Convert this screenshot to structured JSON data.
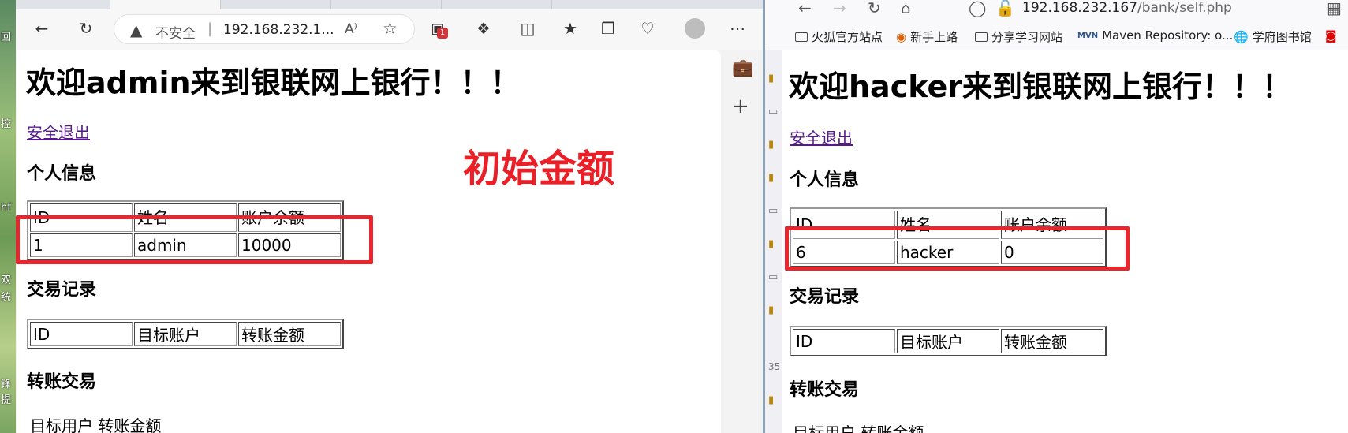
{
  "desktop": {
    "labels": [
      "回",
      "控",
      "hf",
      "双",
      "统",
      "锋",
      "提",
      "35"
    ]
  },
  "edge": {
    "address": {
      "insecure_label": "不安全",
      "separator": "|",
      "url": "192.168.232.1...",
      "read_aloud_glyph": "A⁾"
    },
    "extension_badge": "1",
    "page": {
      "welcome": "欢迎admin来到银联网上银行！！！",
      "logout": "安全退出",
      "personal_info_title": "个人信息",
      "info_headers": [
        "ID",
        "姓名",
        "账户余额"
      ],
      "info_row": [
        "1",
        "admin",
        "10000"
      ],
      "transactions_title": "交易记录",
      "tx_headers": [
        "ID",
        "目标账户",
        "转账金额"
      ],
      "transfer_title": "转账交易",
      "transfer_labels": "目标用户 转账金额"
    }
  },
  "annotation": {
    "text": "初始金额",
    "color": "#e8262e"
  },
  "firefox": {
    "url_host": "192.168.232.167",
    "url_path": "/bank/self.php",
    "bookmarks": [
      "火狐官方站点",
      "新手上路",
      "分享学习网站",
      "Maven Repository: o...",
      "学府图书馆"
    ],
    "page": {
      "welcome": "欢迎hacker来到银联网上银行！！！",
      "logout": "安全退出",
      "personal_info_title": "个人信息",
      "info_headers": [
        "ID",
        "姓名",
        "账户余额"
      ],
      "info_row": [
        "6",
        "hacker",
        "0"
      ],
      "transactions_title": "交易记录",
      "tx_headers": [
        "ID",
        "目标账户",
        "转账金额"
      ],
      "transfer_title": "转账交易",
      "transfer_labels": "目标用户 转账金额"
    }
  }
}
